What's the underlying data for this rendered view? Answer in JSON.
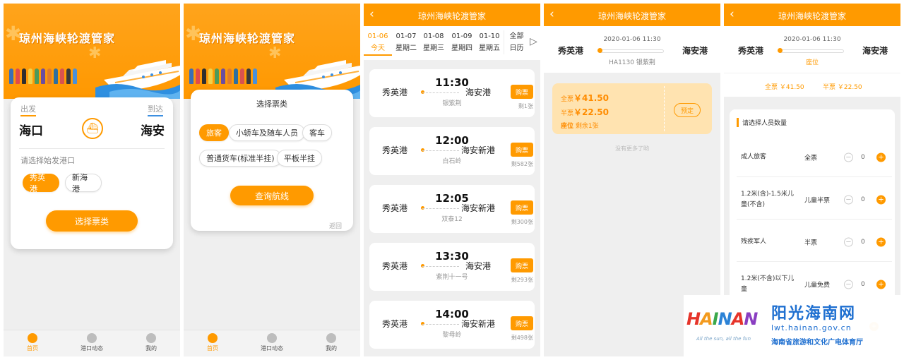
{
  "home": {
    "brand": "琼州海峡轮渡管家",
    "from_label": "出发",
    "to_label": "到达",
    "from_city": "海口",
    "to_city": "海安",
    "port_hint": "请选择始发港口",
    "ports": [
      "秀英港",
      "新海港"
    ],
    "select_button": "选择票类"
  },
  "ticket_type": {
    "title": "选择票类",
    "types": [
      "旅客",
      "小轿车及随车人员",
      "客车",
      "普通货车(标准半挂)",
      "平板半挂"
    ],
    "query_button": "查询航线",
    "back_link": "返回"
  },
  "tabbar": {
    "items": [
      "首页",
      "港口动态",
      "我的"
    ]
  },
  "colors": {
    "accent": "#ff9a00",
    "brand_blue": "#1e6fd0"
  },
  "schedule": {
    "title": "琼州海峡轮渡管家",
    "dates": [
      {
        "date": "01-06",
        "day": "今天"
      },
      {
        "date": "01-07",
        "day": "星期二"
      },
      {
        "date": "01-08",
        "day": "星期三"
      },
      {
        "date": "01-09",
        "day": "星期四"
      },
      {
        "date": "01-10",
        "day": "星期五"
      }
    ],
    "all_label": "全部",
    "calendar_label": "日历",
    "buy_label": "购票",
    "trips": [
      {
        "from": "秀英港",
        "time": "11:30",
        "to": "海安港",
        "ship": "银紫荆",
        "left": "剩1张"
      },
      {
        "from": "秀英港",
        "time": "12:00",
        "to": "海安新港",
        "ship": "白石岭",
        "left": "剩582张"
      },
      {
        "from": "秀英港",
        "time": "12:05",
        "to": "海安新港",
        "ship": "双泰12",
        "left": "剩300张"
      },
      {
        "from": "秀英港",
        "time": "13:30",
        "to": "海安港",
        "ship": "紫荆十一号",
        "left": "剩293张"
      },
      {
        "from": "秀英港",
        "time": "14:00",
        "to": "海安新港",
        "ship": "黎母岭",
        "left": "剩498张"
      }
    ]
  },
  "detail": {
    "title": "琼州海峡轮渡管家",
    "from": "秀英港",
    "to": "海安港",
    "datetime": "2020-01-06 11:30",
    "voyage": "HA1130 银紫荆",
    "full_label": "全票",
    "full_price": "￥41.50",
    "half_label": "半票",
    "half_price": "￥22.50",
    "seat_label": "座位",
    "seat_left": "剩余1张",
    "reserve": "预定",
    "no_more": "没有更多了哟"
  },
  "passengers": {
    "title": "琼州海峡轮渡管家",
    "from": "秀英港",
    "to": "海安港",
    "datetime": "2020-01-06 11:30",
    "seat_label": "座位",
    "full_price": "全票 ￥41.50",
    "half_price": "半票 ￥22.50",
    "section": "请选择人员数量",
    "rows": [
      {
        "name": "成人旅客",
        "type": "全票",
        "count": "0"
      },
      {
        "name": "1.2米(含)-1.5米儿童(不含)",
        "type": "儿童半票",
        "count": "0"
      },
      {
        "name": "残疾军人",
        "type": "半票",
        "count": "0"
      },
      {
        "name": "1.2米(不含)以下儿童",
        "type": "儿童免费",
        "count": "0"
      }
    ]
  },
  "watermark": {
    "brand": "HAINAN",
    "tagline": "All the sun, all the fun",
    "site": "阳光海南网",
    "url": "lwt.hainan.gov.cn",
    "org": "海南省旅游和文化广电体育厅"
  }
}
